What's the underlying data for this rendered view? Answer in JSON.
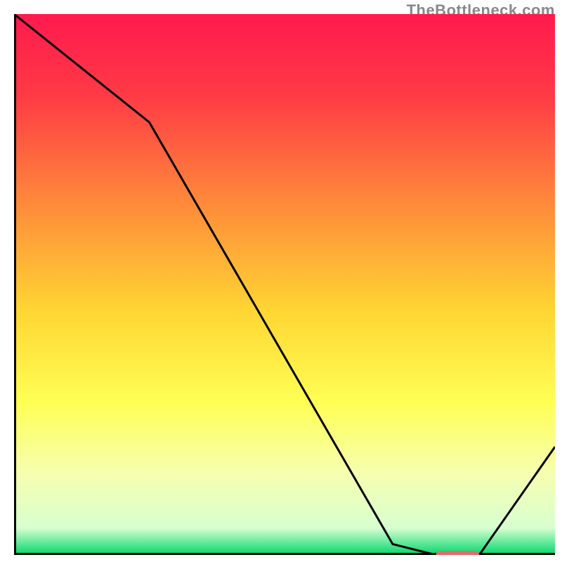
{
  "watermark": "TheBottleneck.com",
  "chart_data": {
    "type": "line",
    "title": "",
    "xlabel": "",
    "ylabel": "",
    "xlim": [
      0,
      100
    ],
    "ylim": [
      0,
      100
    ],
    "grid": false,
    "x": [
      0,
      25,
      70,
      78,
      86,
      100
    ],
    "values": [
      100,
      80,
      2,
      0,
      0,
      20
    ],
    "marker": {
      "x_start": 78,
      "x_end": 86,
      "y": 0,
      "color": "#e56b6b"
    },
    "gradient_stops": [
      {
        "pos": 0.0,
        "color": "#ff1a4e"
      },
      {
        "pos": 0.15,
        "color": "#ff3a45"
      },
      {
        "pos": 0.35,
        "color": "#ff8a3a"
      },
      {
        "pos": 0.55,
        "color": "#ffd633"
      },
      {
        "pos": 0.72,
        "color": "#ffff55"
      },
      {
        "pos": 0.85,
        "color": "#f6ffb0"
      },
      {
        "pos": 0.95,
        "color": "#d8ffd0"
      },
      {
        "pos": 1.0,
        "color": "#00d66b"
      }
    ],
    "axis_color": "#000000",
    "axis_width": 6,
    "line_color": "#000000",
    "line_width": 3
  }
}
